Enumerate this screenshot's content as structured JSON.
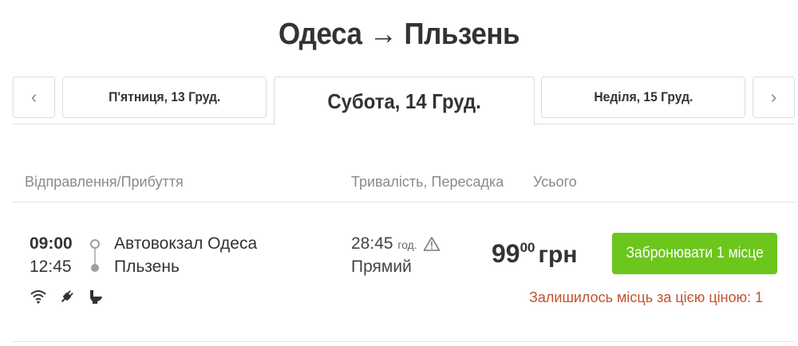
{
  "page": {
    "title": "Одеса → Пльзень"
  },
  "dates": {
    "prev_arrow": "‹",
    "next_arrow": "›",
    "tabs": [
      {
        "label": "П'ятниця, 13 Груд.",
        "active": false
      },
      {
        "label": "Субота, 14 Груд.",
        "active": true
      },
      {
        "label": "Неділя, 15 Груд.",
        "active": false
      }
    ]
  },
  "columns": {
    "departure_arrival": "Відправлення/Прибуття",
    "duration_transfer": "Тривалість, Пересадка",
    "total": "Усього"
  },
  "trip": {
    "departure_time": "09:00",
    "arrival_time": "12:45",
    "from": "Автовокзал Одеса",
    "to": "Пльзень",
    "duration": "28:45",
    "duration_unit": "год.",
    "transfer": "Прямий",
    "amenities": [
      "wifi-icon",
      "power-plug-icon",
      "toilet-icon"
    ],
    "price_int": "99",
    "price_dec": "00",
    "currency": "грн",
    "book_label": "Забронювати 1 місце",
    "seats_left": "Залишилось місць за цією ціною: 1"
  },
  "colors": {
    "accent_green": "#6cc61b",
    "warning_text": "#c0522d",
    "text_main": "#333333",
    "text_muted": "#8a8a8a"
  }
}
